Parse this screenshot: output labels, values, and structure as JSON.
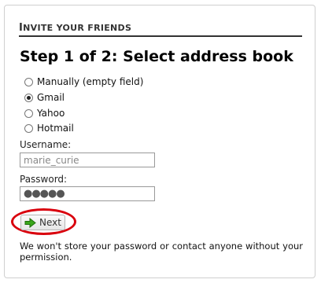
{
  "section": {
    "title_first_letter": "I",
    "title_rest": "NVITE YOUR FRIENDS"
  },
  "step": {
    "heading": "Step 1 of 2: Select address book"
  },
  "address_book": {
    "options": [
      {
        "label": "Manually (empty field)",
        "checked": false
      },
      {
        "label": "Gmail",
        "checked": true
      },
      {
        "label": "Yahoo",
        "checked": false
      },
      {
        "label": "Hotmail",
        "checked": false
      }
    ]
  },
  "form": {
    "username_label": "Username:",
    "username_value": "marie_curie",
    "password_label": "Password:",
    "password_masked": "●●●●●"
  },
  "actions": {
    "next_label": "Next"
  },
  "notice": {
    "text": "We won't store your password or contact anyone without your permission."
  },
  "colors": {
    "highlight": "#d9000d",
    "next_icon_green": "#3aa61a"
  }
}
